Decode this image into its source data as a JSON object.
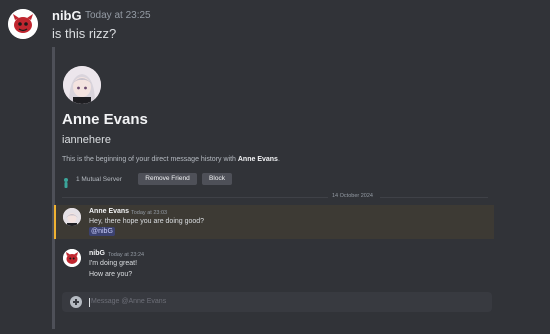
{
  "outer_message": {
    "username": "nibG",
    "timestamp": "Today at 23:25",
    "text": "is this rizz?"
  },
  "profile": {
    "display_name": "Anne Evans",
    "username": "iannehere",
    "intro_prefix": "This is the beginning of your direct message history with ",
    "intro_name": "Anne Evans",
    "intro_suffix": ".",
    "mutual_servers": "1 Mutual Server",
    "remove_friend_label": "Remove Friend",
    "block_label": "Block"
  },
  "date_divider": "14 October 2024",
  "messages": [
    {
      "username": "Anne Evans",
      "timestamp": "Today at 23:03",
      "lines": [
        "Hey, there hope you are doing good?"
      ],
      "mention": "@nibG"
    },
    {
      "username": "nibG",
      "timestamp": "Today at 23:24",
      "lines": [
        "I'm doing great!",
        "How are you?"
      ]
    }
  ],
  "composer": {
    "placeholder": "Message @Anne Evans"
  },
  "colors": {
    "background": "#313338",
    "mention_highlight": "#f0b232",
    "mention_pill": "#3c4270"
  }
}
